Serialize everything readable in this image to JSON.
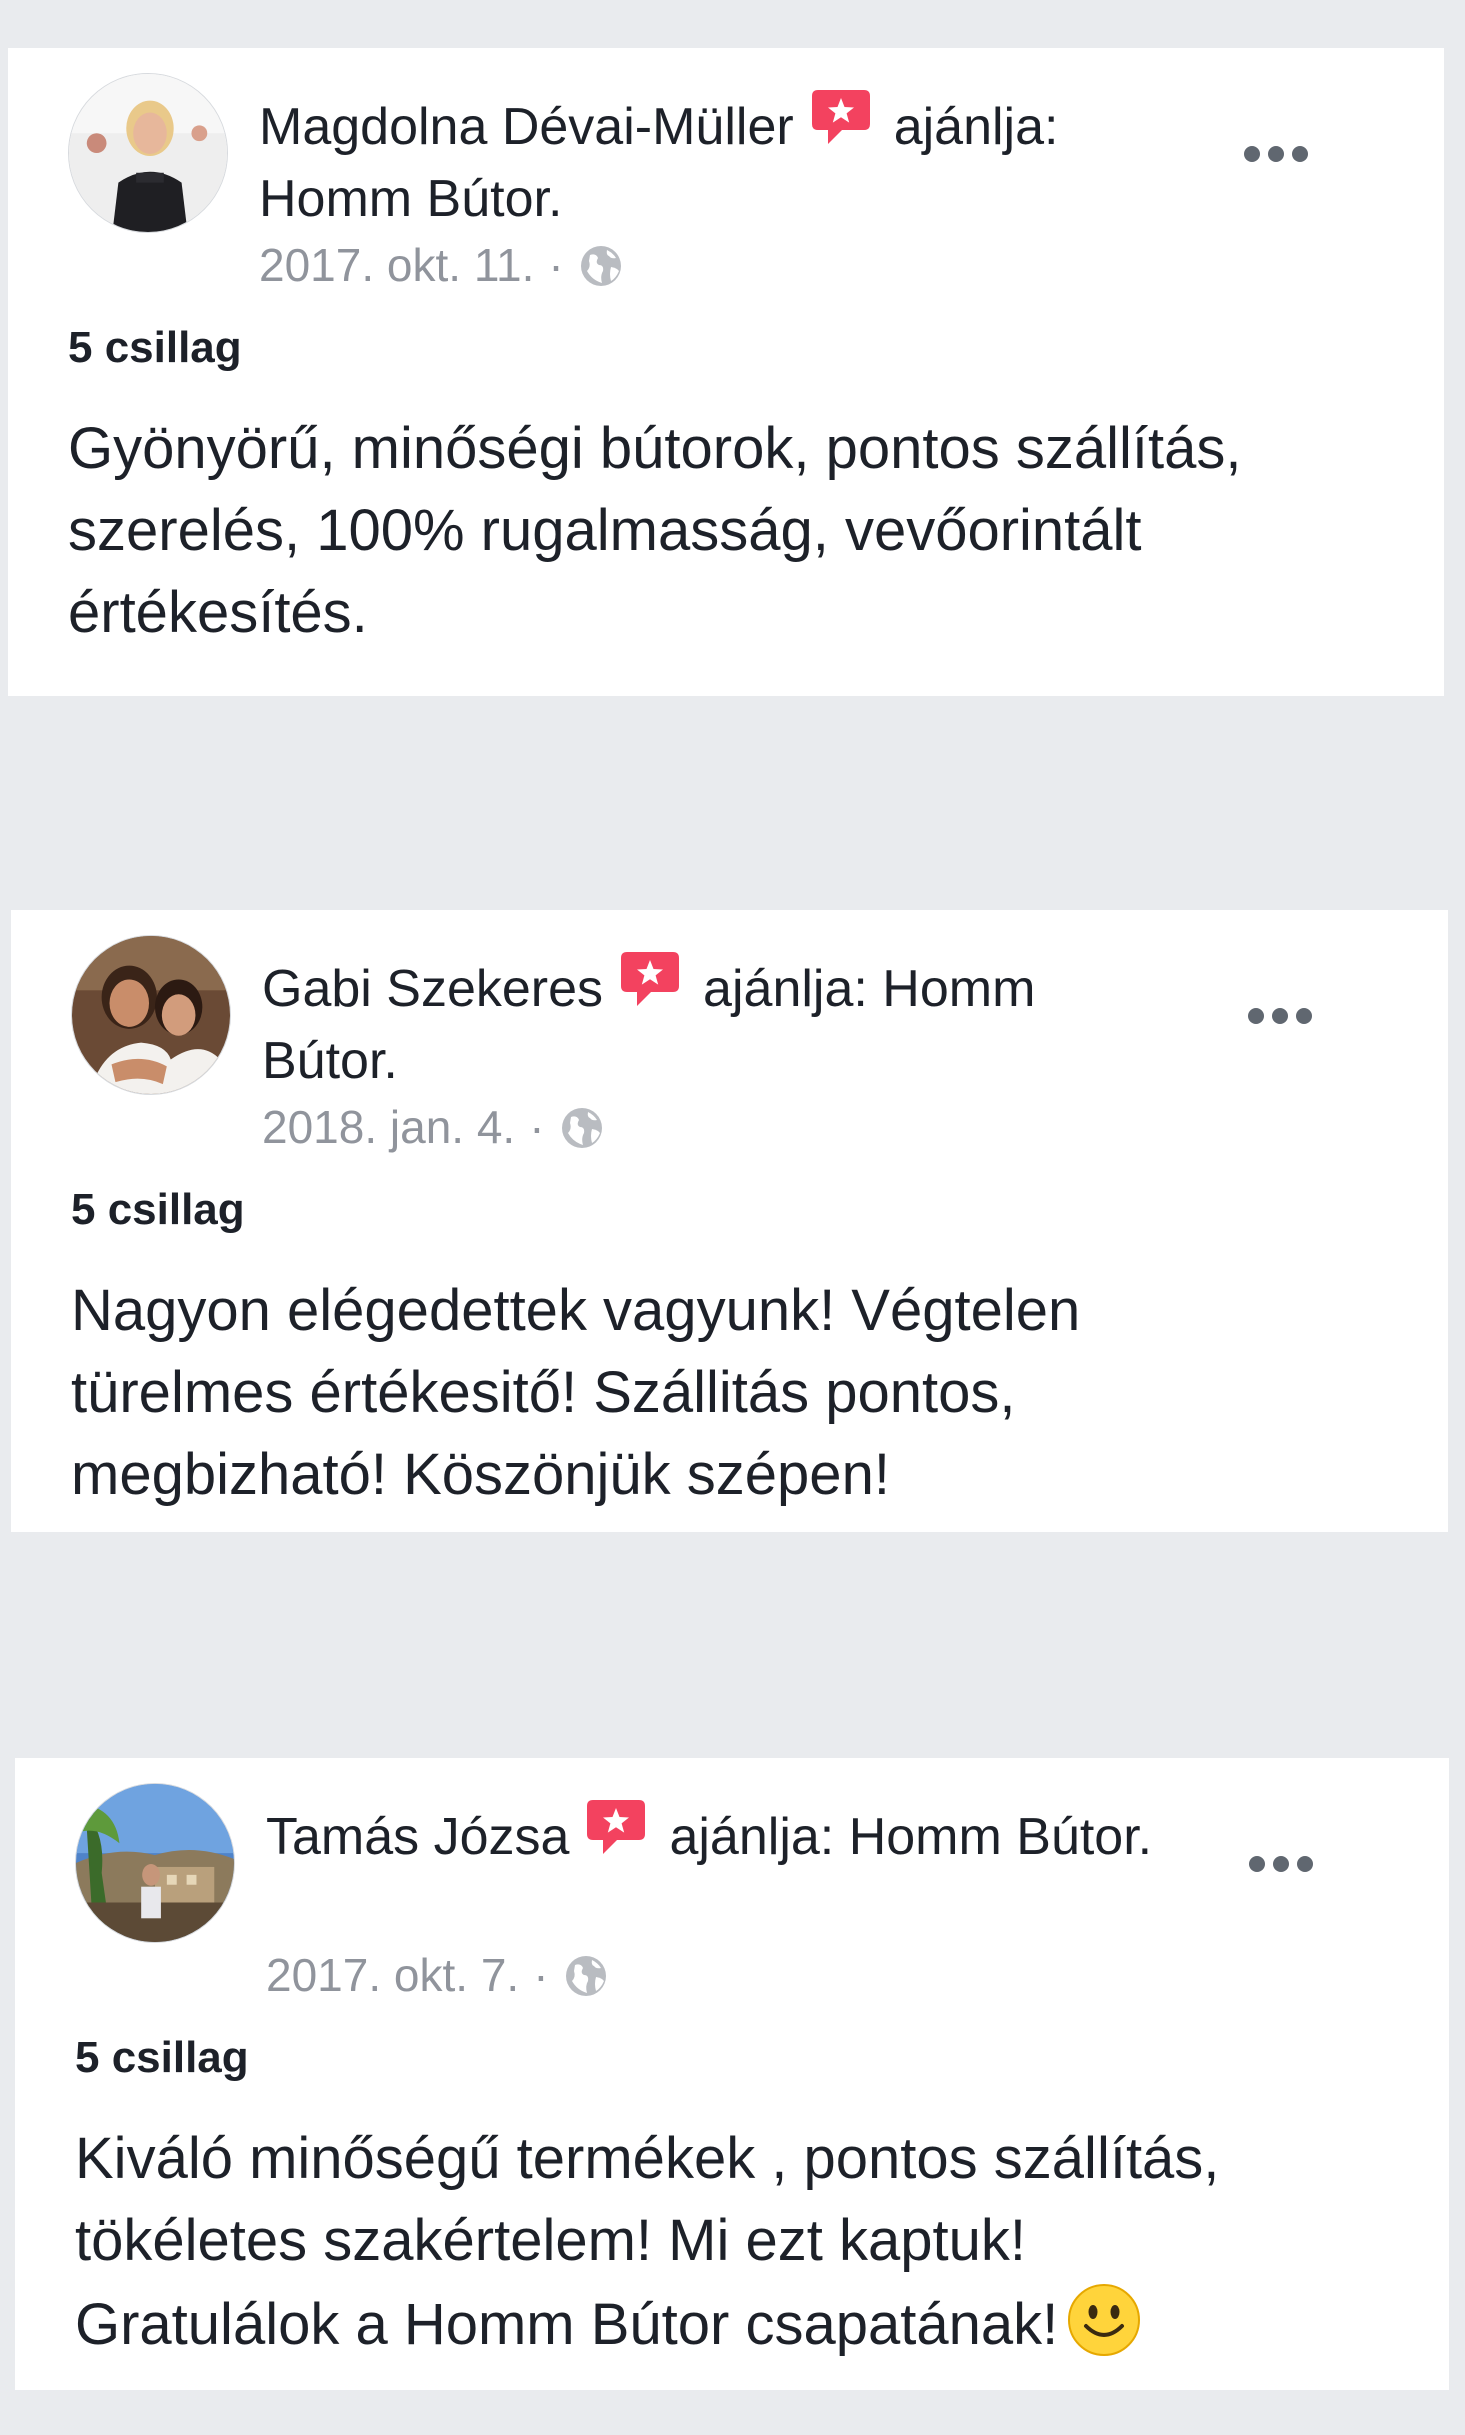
{
  "colors": {
    "page_background": "#e9ebee",
    "card_background": "#ffffff",
    "text_primary": "#1d2129",
    "text_secondary": "#90949c",
    "badge_accent": "#f3425f"
  },
  "reviews": [
    {
      "author": "Magdolna Dévai-Müller",
      "action": "ajánlja:",
      "page": "Homm Bútor.",
      "date": "2017. okt. 11.",
      "separator": "·",
      "audience_icon": "globe-icon",
      "rating": "5 csillag",
      "text": "Gyönyörű, minőségi bútorok, pontos szállítás,\nszerelés, 100% rugalmasság, vevőorintált\nértékesítés."
    },
    {
      "author": "Gabi Szekeres",
      "action": "ajánlja:",
      "page": "Homm Bútor.",
      "date": "2018. jan. 4.",
      "separator": "·",
      "audience_icon": "globe-icon",
      "rating": "5 csillag",
      "text": "Nagyon elégedettek vagyunk! Végtelen\ntürelmes értékesitő! Szállitás pontos,\nmegbizható! Köszönjük szépen!"
    },
    {
      "author": "Tamás Józsa",
      "action": "ajánlja:",
      "page": "Homm Bútor.",
      "date": "2017. okt. 7.",
      "separator": "·",
      "audience_icon": "globe-icon",
      "rating": "5 csillag",
      "text": "Kiváló minőségű termékek ,  pontos szállítás,\ntökéletes szakértelem! Mi ezt kaptuk!\nGratulálok a Homm Bútor csapatának!"
    }
  ]
}
